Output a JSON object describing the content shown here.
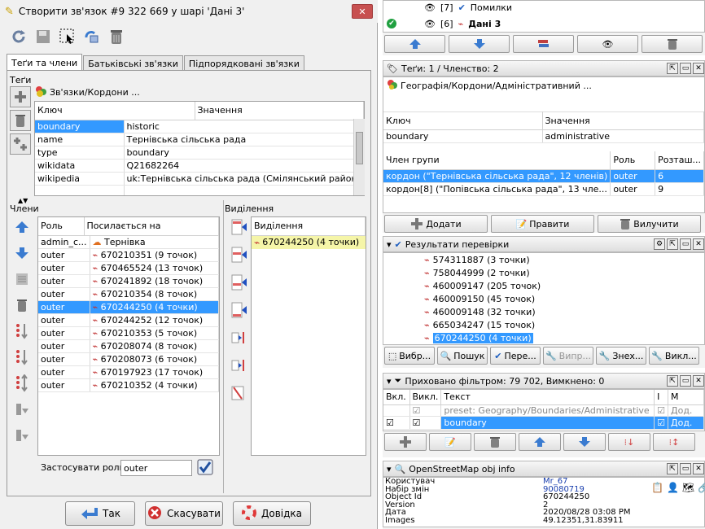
{
  "dialog": {
    "title": "Створити зв'язок #9 322 669 у шарі 'Дані 3'",
    "tabs": [
      "Теґи та члени",
      "Батьківські зв'язки",
      "Підпорядковані зв'язки"
    ],
    "tags_label": "Теґи",
    "preset_label": "Зв'язки/Кордони ...",
    "tag_columns": [
      "Ключ",
      "Значення"
    ],
    "tags": [
      {
        "key": "boundary",
        "value": "historic"
      },
      {
        "key": "name",
        "value": "Тернівська сільська рада"
      },
      {
        "key": "type",
        "value": "boundary"
      },
      {
        "key": "wikidata",
        "value": "Q21682264"
      },
      {
        "key": "wikipedia",
        "value": "uk:Тернівська сільська рада (Смілянський район)"
      }
    ],
    "members_label": "Члени",
    "selection_label": "Виділення",
    "member_columns": [
      "Роль",
      "Посилається на"
    ],
    "members": [
      {
        "role": "admin_c...",
        "ref": "Тернівка"
      },
      {
        "role": "outer",
        "ref": "670210351 (9 точок)"
      },
      {
        "role": "outer",
        "ref": "670465524 (13 точок)"
      },
      {
        "role": "outer",
        "ref": "670241892 (18 точок)"
      },
      {
        "role": "outer",
        "ref": "670210354 (8 точок)"
      },
      {
        "role": "outer",
        "ref": "670244250 (4 точки)"
      },
      {
        "role": "outer",
        "ref": "670244252 (12 точок)"
      },
      {
        "role": "outer",
        "ref": "670210353 (5 точок)"
      },
      {
        "role": "outer",
        "ref": "670208074 (8 точок)"
      },
      {
        "role": "outer",
        "ref": "670208073 (6 точок)"
      },
      {
        "role": "outer",
        "ref": "670197923 (17 точок)"
      },
      {
        "role": "outer",
        "ref": "670210352 (4 точки)"
      }
    ],
    "selected_member_index": 5,
    "selection_column": "Виділення",
    "selection_items": [
      "670244250 (4 точки)"
    ],
    "apply_role_label": "Застосувати роль:",
    "apply_role_value": "outer",
    "ok_label": "Так",
    "cancel_label": "Скасувати",
    "help_label": "Довідка"
  },
  "layers": {
    "items": [
      {
        "index": "[7]",
        "name": "Помилки"
      },
      {
        "index": "[6]",
        "name": "Дані 3"
      }
    ]
  },
  "tags_panel": {
    "title": "Теґи: 1 / Членство: 2",
    "preset": "Географія/Кордони/Адміністративний ...",
    "columns": [
      "Ключ",
      "Значення"
    ],
    "tags": [
      {
        "key": "boundary",
        "value": "administrative"
      }
    ],
    "member_columns": [
      "Член групи",
      "Роль",
      "Розташ..."
    ],
    "memberships": [
      {
        "group": "кордон (\"Тернівська сільська рада\", 12 членів)",
        "role": "outer",
        "pos": "6"
      },
      {
        "group": "кордон[8] (\"Попівська сільська рада\", 13 чле...",
        "role": "outer",
        "pos": "9"
      }
    ],
    "add_label": "Додати",
    "edit_label": "Правити",
    "delete_label": "Вилучити"
  },
  "validation": {
    "title": "Результати перевірки",
    "items": [
      "574311887 (3 точки)",
      "758044999 (2 точки)",
      "460009147 (205 точок)",
      "460009150 (45 точок)",
      "460009148 (32 точки)",
      "665034247 (15 точок)",
      "670244250 (4 точки)"
    ],
    "buttons": [
      "Вибр...",
      "Пошук",
      "Пере...",
      "Випр...",
      "Знех...",
      "Викл..."
    ]
  },
  "filter": {
    "title": "Приховано фільтром: 79 702, Вимкнено: 0",
    "columns": [
      "Вкл.",
      "Викл.",
      "Текст",
      "I",
      "M"
    ],
    "rows": [
      {
        "text": "preset: Geography/Boundaries/Administrative",
        "m": "Дод."
      },
      {
        "text": "boundary",
        "m": "Дод."
      }
    ]
  },
  "objinfo": {
    "title": "OpenStreetMap obj info",
    "rows": [
      {
        "label": "Користувач",
        "value": "Mr_67"
      },
      {
        "label": "Набір змін",
        "value": "90080719"
      },
      {
        "label": "Object Id",
        "value": "670244250"
      },
      {
        "label": "Version",
        "value": "2"
      },
      {
        "label": "Дата",
        "value": "2020/08/28 03:08 PM"
      },
      {
        "label": "Images",
        "value": "49.12351,31.83911"
      }
    ]
  },
  "colors": {
    "selection": "#3399ff",
    "link": "#1a3fae"
  }
}
